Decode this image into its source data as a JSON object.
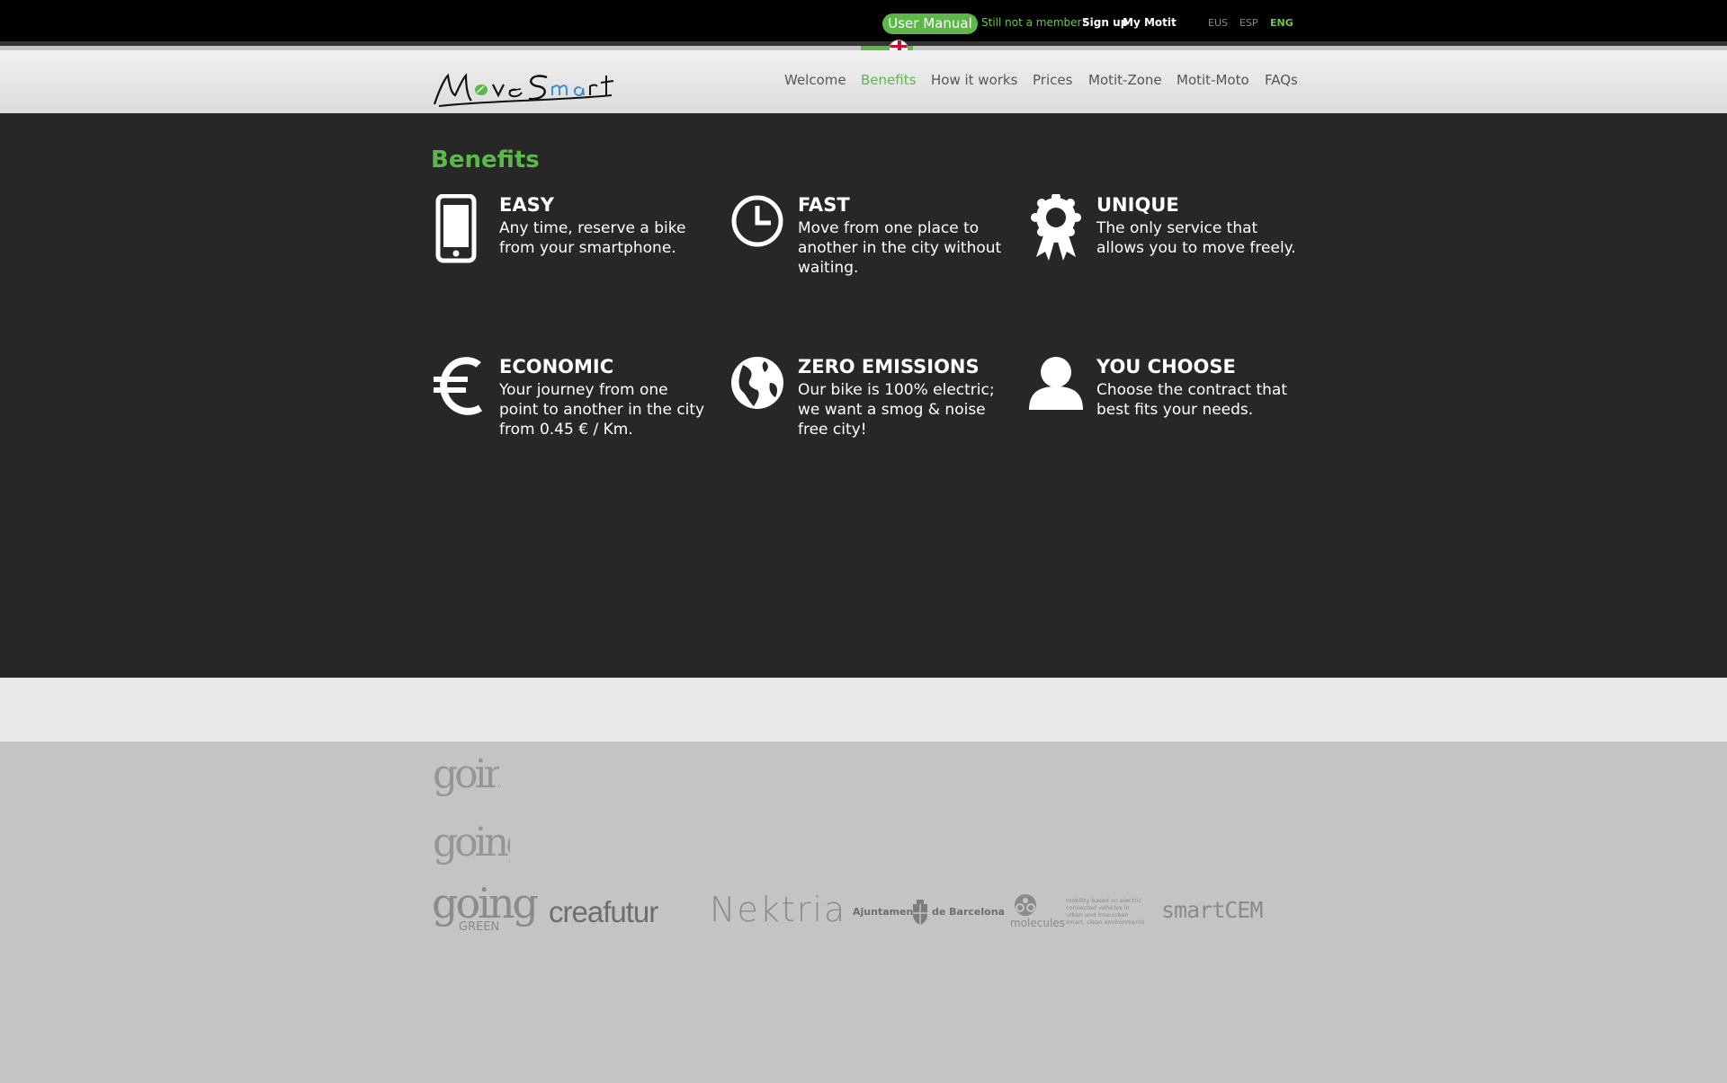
{
  "topbar": {
    "user_manual": "User Manual",
    "member_text": "Still not a member?",
    "signup": "Sign up",
    "my_motit": "My Motit",
    "languages": [
      "EUS",
      "ESP",
      "ENG"
    ],
    "active_language": "ENG"
  },
  "header": {
    "logo_text": "MoveSmart",
    "nav": [
      "Welcome",
      "Benefits",
      "How it works",
      "Prices",
      "Motit-Zone",
      "Motit-Moto",
      "FAQs"
    ],
    "active_nav": "Benefits"
  },
  "main": {
    "title": "Benefits",
    "benefits": [
      {
        "icon": "smartphone-icon",
        "title": "EASY",
        "text": "Any time, reserve a bike from your smartphone."
      },
      {
        "icon": "clock-icon",
        "title": "FAST",
        "text": "Move from one place to another in the city without waiting."
      },
      {
        "icon": "award-icon",
        "title": "UNIQUE",
        "text": "The only service that allows you to move freely."
      },
      {
        "icon": "euro-icon",
        "title": "ECONOMIC",
        "text": "Your journey from one point to another in the city from 0.45 € / Km."
      },
      {
        "icon": "globe-icon",
        "title": "ZERO EMISSIONS",
        "text": "Our bike is 100% electric; we want a smog & noise free city!"
      },
      {
        "icon": "user-icon",
        "title": "YOU CHOOSE",
        "text": "Choose the contract that best fits your needs."
      }
    ]
  },
  "sponsors": {
    "going_green": "going",
    "going_green_sub": "GREEN",
    "creafutur": "creafutur",
    "nektria": "Nektria",
    "ajuntament_left": "Ajuntament",
    "ajuntament_right": "de Barcelona",
    "molecules": "molecules",
    "molecules_desc": "mobility based on electric connected vehicles in urban and interurban smart, clean environments",
    "smartcem": "smartCEM"
  },
  "colors": {
    "accent": "#5cb848",
    "dark_bg": "#272727",
    "footer_bg": "#c4c4c4"
  }
}
